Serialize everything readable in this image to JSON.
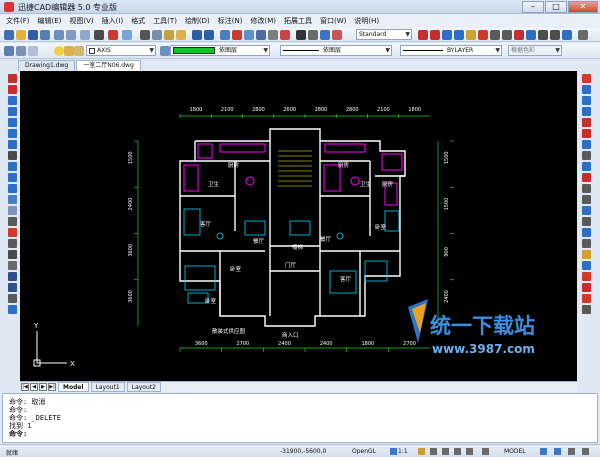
{
  "window": {
    "title": "迅捷CAD编辑器 5.0 专业版",
    "minimize": "–",
    "maximize": "□",
    "close": "✕"
  },
  "menu": [
    "文件(F)",
    "编辑(E)",
    "视图(V)",
    "插入(I)",
    "格式",
    "工具(T)",
    "绘制(D)",
    "标注(N)",
    "修改(M)",
    "拓展工具",
    "窗口(W)",
    "说明(H)"
  ],
  "toolbar1": {
    "text_style": "Standard"
  },
  "toolbar2": {
    "layer": "AXIS",
    "color": "依图层",
    "color_swatch": "#1fbf2a",
    "linetype": "依图层",
    "lineweight": "BYLAYER",
    "plotstyle": "根据色彩"
  },
  "doc_tabs": [
    {
      "label": "Drawing1.dwg"
    },
    {
      "label": "一室二厅N06.dwg"
    }
  ],
  "layout_tabs": [
    "Model",
    "Layout1",
    "Layout2"
  ],
  "command_lines": [
    "命令: 取消",
    "命令:",
    "命令: _DELETE",
    "找到 1",
    "命令:"
  ],
  "status": {
    "left": "就绪",
    "coords": "-31900,-5600,0",
    "mode1": "OpenGL",
    "scale": "1:1",
    "model": "MODEL"
  },
  "drawing": {
    "dims_top": [
      "1800",
      "2100",
      "2800",
      "2600",
      "2800",
      "2800",
      "2100",
      "1800"
    ],
    "dims_bottom": [
      "3600",
      "2700",
      "2400",
      "2400",
      "1800",
      "2700"
    ],
    "dims_left": [
      "1500",
      "2400",
      "3600",
      "3600"
    ],
    "dims_right": [
      "1500",
      "1500",
      "900",
      "2400"
    ],
    "rooms": [
      "厨房",
      "厨房",
      "卫生",
      "卫生",
      "客厅",
      "餐厅",
      "卧室",
      "卧室",
      "门厅",
      "楼梯",
      "客厅",
      "餐厅",
      "卧室",
      "厨房"
    ],
    "labels": [
      "散装式供应图",
      "商入口"
    ],
    "axis_x": "X",
    "axis_y": "Y"
  },
  "watermark": {
    "text": "统一下载站",
    "url": "www.3987.com"
  },
  "colors": {
    "wall": "#ffffff",
    "accent": "#ff00ff",
    "dim": "#ffff00",
    "furniture": "#00d8ff",
    "green": "#2bd22b"
  }
}
